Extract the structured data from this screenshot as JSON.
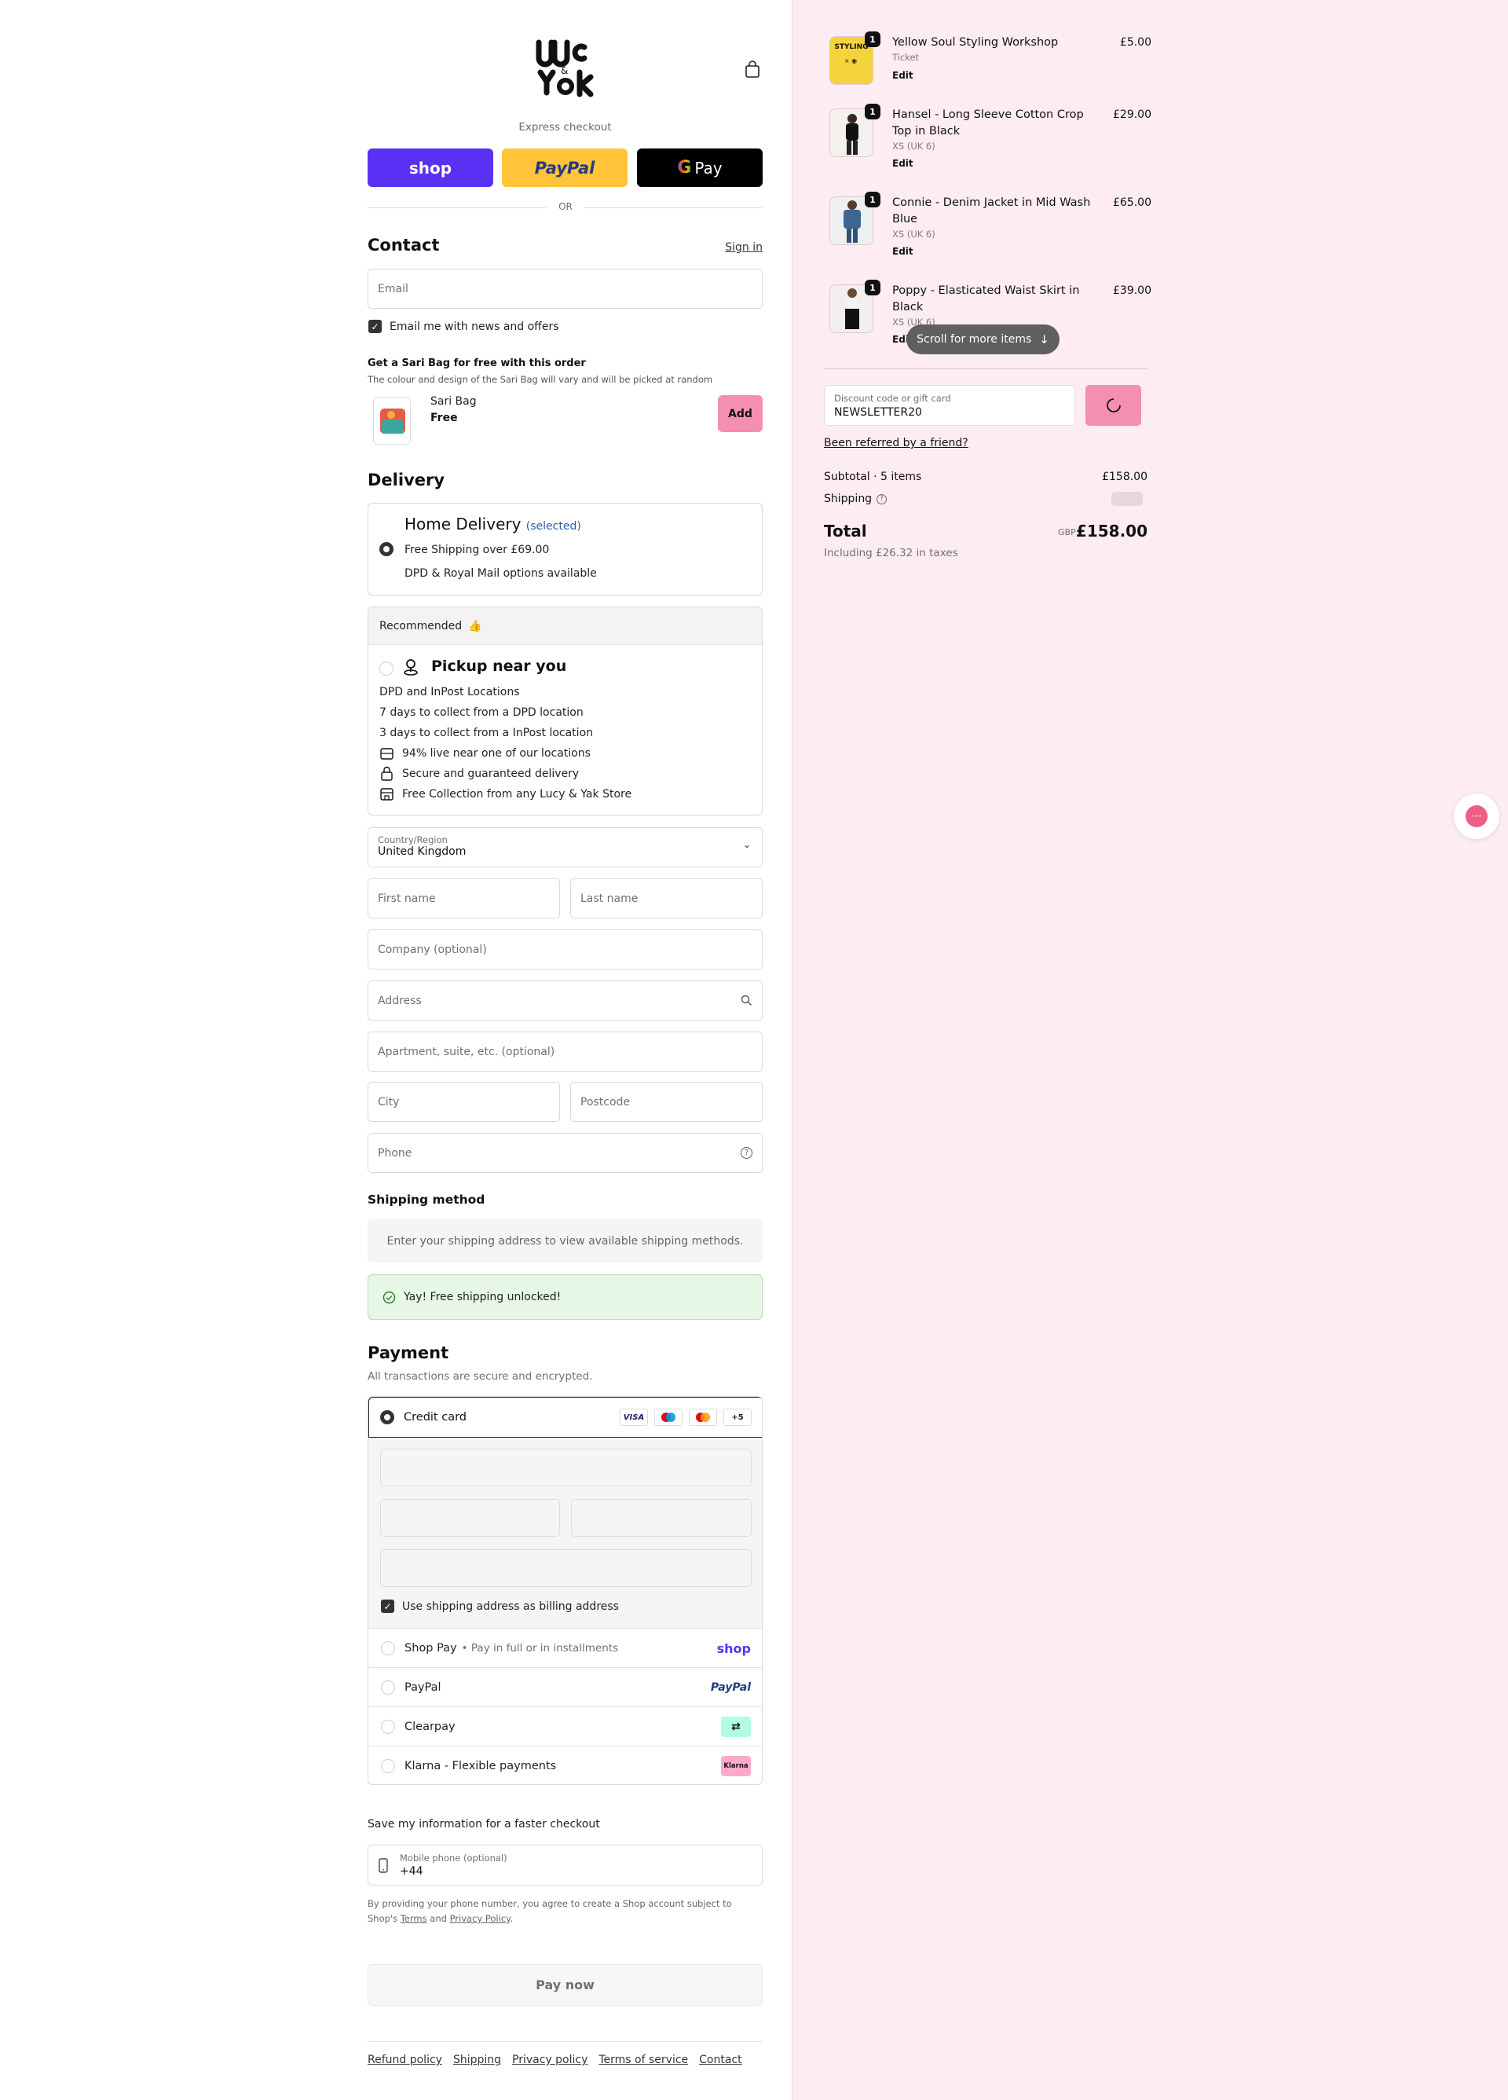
{
  "express": {
    "label": "Express checkout",
    "shop_label": "shop",
    "paypal_label": "PayPal",
    "gpay_label": "Pay",
    "or_label": "OR"
  },
  "contact": {
    "title": "Contact",
    "sign_in": "Sign in",
    "email_placeholder": "Email",
    "news_label": "Email me with news and offers"
  },
  "promo": {
    "title": "Get a Sari Bag for free with this order",
    "subtitle": "The colour and design of the Sari Bag will vary and will be picked at random",
    "item_name": "Sari Bag",
    "item_price": "Free",
    "add_label": "Add"
  },
  "delivery": {
    "title": "Delivery",
    "home": {
      "title": "Home Delivery",
      "selected": "(selected)",
      "line1": "Free Shipping over £69.00",
      "line2": "DPD & Royal Mail options available"
    },
    "pickup": {
      "recommended": "Recommended",
      "title": "Pickup near you",
      "lines": [
        "DPD and InPost Locations",
        "7 days to collect from a DPD location",
        "3 days to collect from a InPost location"
      ],
      "features": [
        "94% live near one of our locations",
        "Secure and guaranteed delivery",
        "Free Collection from any Lucy & Yak Store"
      ]
    }
  },
  "address": {
    "country_label": "Country/Region",
    "country_value": "United Kingdom",
    "first_name": "First name",
    "last_name": "Last name",
    "company": "Company (optional)",
    "address": "Address",
    "apartment": "Apartment, suite, etc. (optional)",
    "city": "City",
    "postcode": "Postcode",
    "phone": "Phone"
  },
  "shipping_method": {
    "title": "Shipping method",
    "placeholder_text": "Enter your shipping address to view available shipping methods.",
    "free_shipping": "Yay! Free shipping unlocked!"
  },
  "payment": {
    "title": "Payment",
    "subtitle": "All transactions are secure and encrypted.",
    "credit_card": "Credit card",
    "card_brands": [
      "VISA",
      "+5"
    ],
    "billing_same": "Use shipping address as billing address",
    "shop_pay": "Shop Pay",
    "shop_pay_note": "• Pay in full or in installments",
    "shop_pay_logo": "shop",
    "paypal": "PayPal",
    "paypal_logo": "PayPal",
    "clearpay": "Clearpay",
    "klarna": "Klarna - Flexible payments",
    "klarna_logo": "Klarna"
  },
  "save_info": {
    "title": "Save my information for a faster checkout",
    "mobile_label": "Mobile phone (optional)",
    "mobile_value": "+44",
    "disclaimer_1": "By providing your phone number, you agree to create a Shop account subject to",
    "disclaimer_2a": "Shop's",
    "terms": "Terms",
    "and": "and",
    "privacy": "Privacy Policy",
    "period": "."
  },
  "pay_now": "Pay now",
  "footer": [
    "Refund policy",
    "Shipping",
    "Privacy policy",
    "Terms of service",
    "Contact"
  ],
  "summary": {
    "items": [
      {
        "title": "Yellow Soul Styling Workshop",
        "sub": "Ticket",
        "edit": "Edit",
        "price": "£5.00",
        "qty": "1",
        "thumb_text": "STYLING"
      },
      {
        "title": "Hansel - Long Sleeve Cotton Crop Top in Black",
        "sub": "XS (UK 6)",
        "edit": "Edit",
        "price": "£29.00",
        "qty": "1"
      },
      {
        "title": "Connie - Denim Jacket in Mid Wash Blue",
        "sub": "XS (UK 6)",
        "edit": "Edit",
        "price": "£65.00",
        "qty": "1"
      },
      {
        "title": "Poppy - Elasticated Waist Skirt in Black",
        "sub": "XS (UK 6)",
        "edit": "Edit",
        "price": "£39.00",
        "qty": "1"
      }
    ],
    "scroll_hint": "Scroll for more items",
    "discount_label": "Discount code or gift card",
    "discount_value": "NEWSLETTER20",
    "referred": "Been referred by a friend?",
    "subtotal_label": "Subtotal · 5 items",
    "subtotal_value": "£158.00",
    "shipping_label": "Shipping",
    "total_label": "Total",
    "currency": "GBP",
    "total_value": "£158.00",
    "taxes": "Including £26.32 in taxes"
  },
  "colors": {
    "accent_pink": "#f48fb1",
    "right_bg": "#fdedf2",
    "shop_purple": "#5a31f4",
    "paypal_yellow": "#ffc439"
  }
}
